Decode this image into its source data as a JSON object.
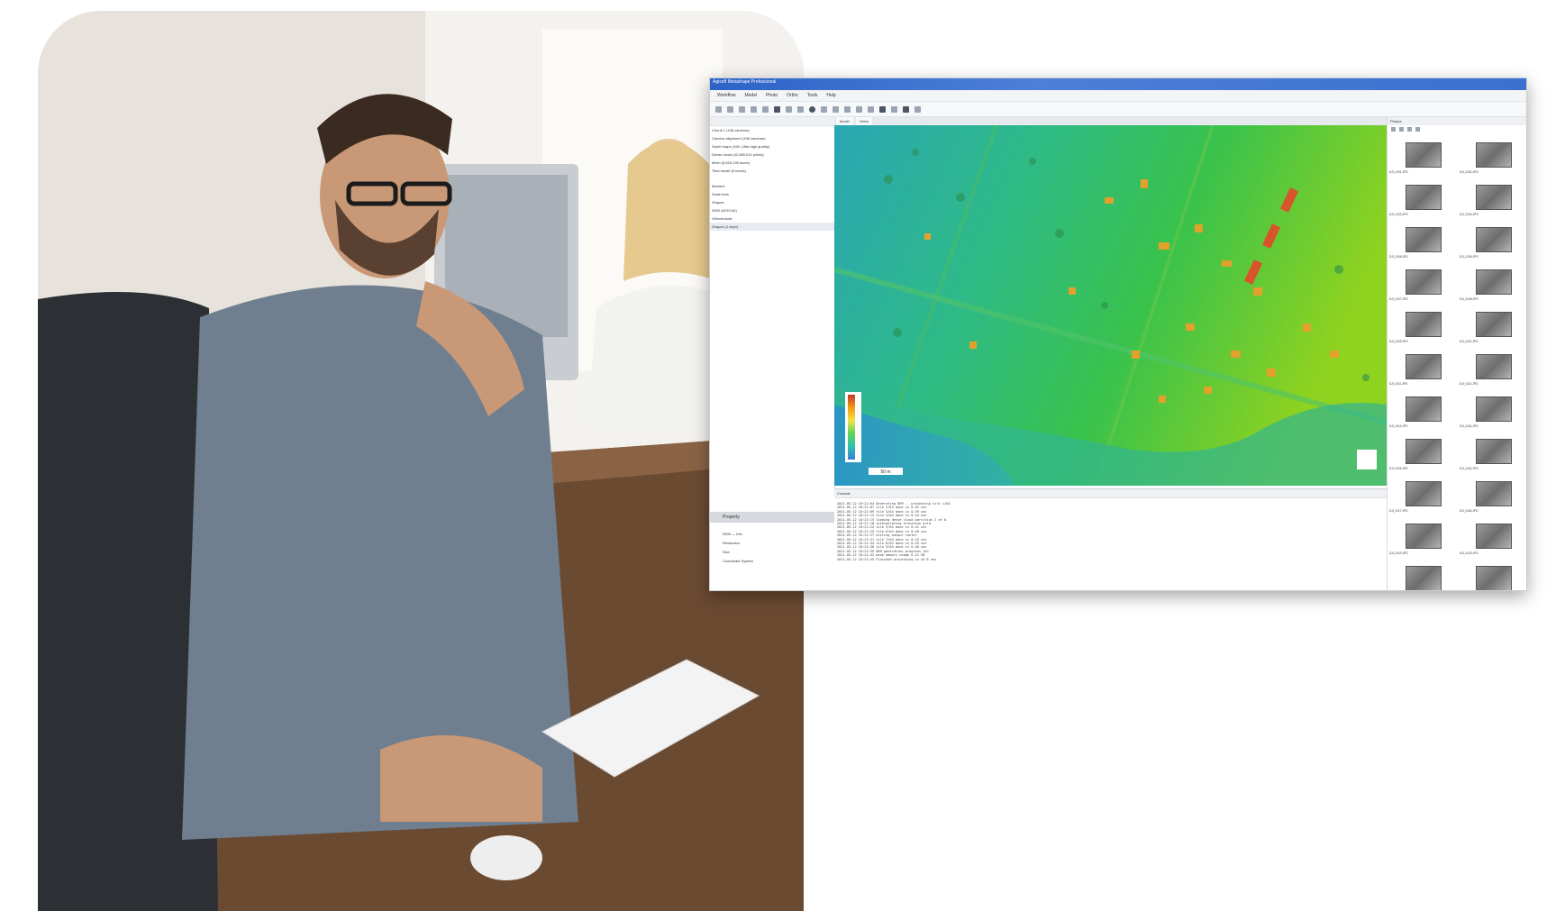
{
  "photo": {
    "description_icon": "photo-icon"
  },
  "app": {
    "title": "Agisoft Metashape Professional",
    "menu": [
      "Workflow",
      "Model",
      "Photo",
      "Ortho",
      "Tools",
      "Help"
    ],
    "left_tabs": [
      "Workspace"
    ],
    "workspace_items": [
      "Chunk 1 (198 cameras)",
      "Camera alignment (198 cameras)",
      "Depth maps (198, Ultra high quality)",
      "Dense cloud (42,580,512 points)",
      "Mesh (8,516,100 faces)",
      "Tiled model (5 levels)",
      "DEM (4.58 cm/pix)",
      "Orthomosaic (1.14 cm/pix)"
    ],
    "workspace_items_2": [
      "Markers",
      "Scale bars",
      "Shapes",
      "DEM (WGS 84)",
      "Orthomosaic",
      "Shapes (1 layer)"
    ],
    "properties_header": "Property",
    "properties": [
      "DEM — Info",
      "Resolution",
      "Size",
      "Coordinate System"
    ],
    "map_tabs": [
      "Model",
      "Ortho"
    ],
    "console_header": "Console",
    "console_lines": [
      "2021-05-12 10:21:04 Generating DEM... processing tile 1/64",
      "2021-05-12 10:21:07 tile 2/64 done in 0.42 sec",
      "2021-05-12 10:21:09 tile 3/64 done in 0.39 sec",
      "2021-05-12 10:21:12 tile 4/64 done in 0.44 sec",
      "2021-05-12 10:21:15 loading dense cloud partition 2 of 8",
      "2021-05-12 10:21:18 interpolating elevation grid",
      "2021-05-12 10:21:22 tile 5/64 done in 0.41 sec",
      "2021-05-12 10:21:25 tile 6/64 done in 0.40 sec",
      "2021-05-12 10:21:27 writing output raster",
      "2021-05-12 10:21:31 tile 7/64 done in 0.43 sec",
      "2021-05-12 10:21:34 tile 8/64 done in 0.45 sec",
      "2021-05-12 10:21:36 tile 9/64 done in 0.40 sec",
      "2021-05-12 10:21:39 DEM generation progress 14%",
      "2021-05-12 10:21:42 peak memory usage 6.21 GB",
      "2021-05-12 10:21:45 Finished processing in 44.6 sec"
    ],
    "photos_header": "Photos",
    "thumbnails": [
      "DJI_0101.JPG",
      "DJI_0102.JPG",
      "DJI_0103.JPG",
      "DJI_0104.JPG",
      "DJI_0105.JPG",
      "DJI_0106.JPG",
      "DJI_0107.JPG",
      "DJI_0108.JPG",
      "DJI_0109.JPG",
      "DJI_0110.JPG",
      "DJI_0111.JPG",
      "DJI_0112.JPG",
      "DJI_0113.JPG",
      "DJI_0114.JPG",
      "DJI_0115.JPG",
      "DJI_0116.JPG",
      "DJI_0117.JPG",
      "DJI_0118.JPG",
      "DJI_0119.JPG",
      "DJI_0120.JPG",
      "DJI_0121.JPG",
      "DJI_0122.JPG"
    ],
    "scale_label": "50 m",
    "legend_colors": [
      "#c0392b",
      "#f39c12",
      "#f1e14b",
      "#5fd45a",
      "#2ebfb0",
      "#3a7fd5"
    ]
  }
}
